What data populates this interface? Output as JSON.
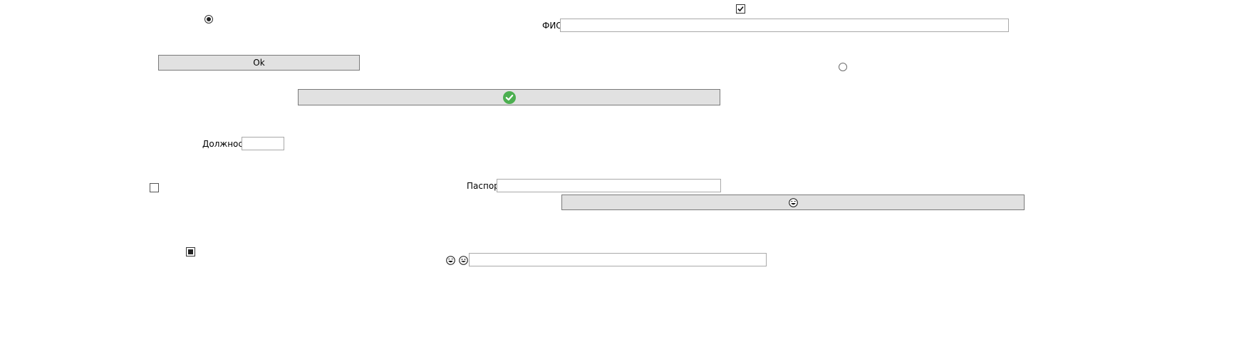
{
  "form": {
    "fio_label": "ФИО",
    "fio_value": "",
    "position_label": "Должность",
    "position_value": "",
    "passport_label": "Паспорт",
    "passport_value": "",
    "extra_value": ""
  },
  "buttons": {
    "ok_label": "Ok",
    "accept_icon": "check-circle-icon",
    "emoji_icon": "laughing-face-icon"
  },
  "controls": {
    "radio_1_checked": true,
    "radio_2_checked": false,
    "checkbox_1_checked": true,
    "checkbox_2_checked": false,
    "checkbox_3_state": "indeterminate"
  },
  "icons": {
    "face_1": "laughing-face-icon",
    "face_2": "grinning-face-icon"
  },
  "colors": {
    "button_bg": "#e1e1e1",
    "accent_check": "#4caf50"
  }
}
